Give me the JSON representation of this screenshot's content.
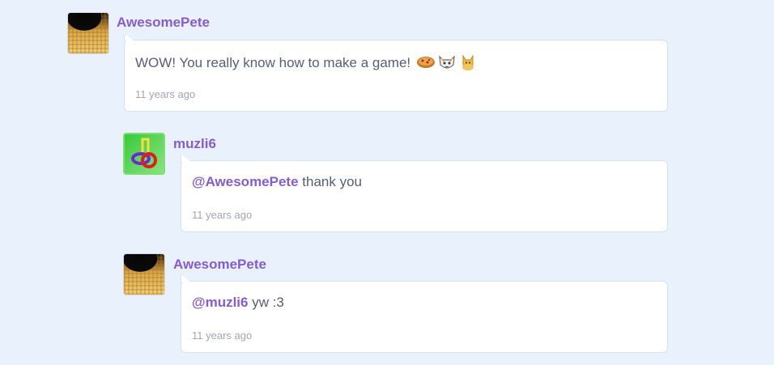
{
  "comments": [
    {
      "username": "AwesomePete",
      "mention": "",
      "text": "WOW! You really know how to make a game! ",
      "emojis": [
        "pizza-emoji",
        "cat-emoji",
        "cat-gold-emoji"
      ],
      "time": "11 years ago"
    },
    {
      "username": "muzli6",
      "mention": "@AwesomePete",
      "text": " thank you",
      "time": "11 years ago"
    },
    {
      "username": "AwesomePete",
      "mention": "@muzli6",
      "text": " yw :3",
      "time": "11 years ago"
    }
  ],
  "colors": {
    "background": "#e9f1fc",
    "username": "#855cd6",
    "text": "#575e75",
    "timestamp": "#a2a6b3"
  }
}
